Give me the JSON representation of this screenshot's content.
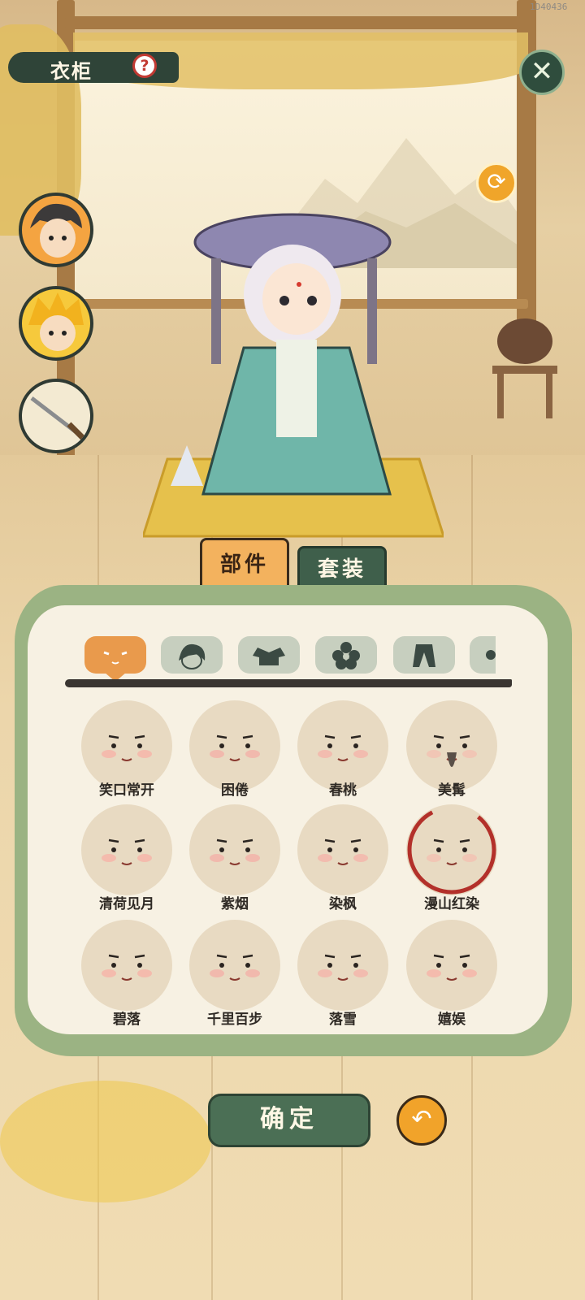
{
  "build_id": "1D40436",
  "header": {
    "title": "衣柜",
    "help_icon": "question-icon",
    "close_icon": "close-x-icon",
    "refresh_icon": "refresh-icon"
  },
  "avatars": [
    {
      "name": "avatar-male-hero"
    },
    {
      "name": "avatar-golden-hair"
    },
    {
      "name": "avatar-sword"
    }
  ],
  "tabs": [
    {
      "label": "部件",
      "active": true
    },
    {
      "label": "套装",
      "active": false
    }
  ],
  "category_tabs": [
    {
      "icon": "face-icon",
      "active": true
    },
    {
      "icon": "hair-icon",
      "active": false
    },
    {
      "icon": "clothes-icon",
      "active": false
    },
    {
      "icon": "flower-icon",
      "active": false
    },
    {
      "icon": "pants-icon",
      "active": false
    },
    {
      "icon": "more-icon",
      "active": false
    }
  ],
  "faces": [
    {
      "label": "笑口常开"
    },
    {
      "label": "困倦"
    },
    {
      "label": "春桃"
    },
    {
      "label": "美髯"
    },
    {
      "label": "清荷见月"
    },
    {
      "label": "紫烟"
    },
    {
      "label": "染枫"
    },
    {
      "label": "漫山红染"
    },
    {
      "label": "碧落"
    },
    {
      "label": "千里百步"
    },
    {
      "label": "落雪"
    },
    {
      "label": "嬉娱"
    }
  ],
  "footer": {
    "confirm_label": "确定",
    "back_icon": "undo-icon"
  },
  "colors": {
    "panel_border": "#9bb383",
    "active_tab": "#e99a4c",
    "confirm_green": "#4b6f55",
    "accent_orange": "#f1a32a"
  }
}
